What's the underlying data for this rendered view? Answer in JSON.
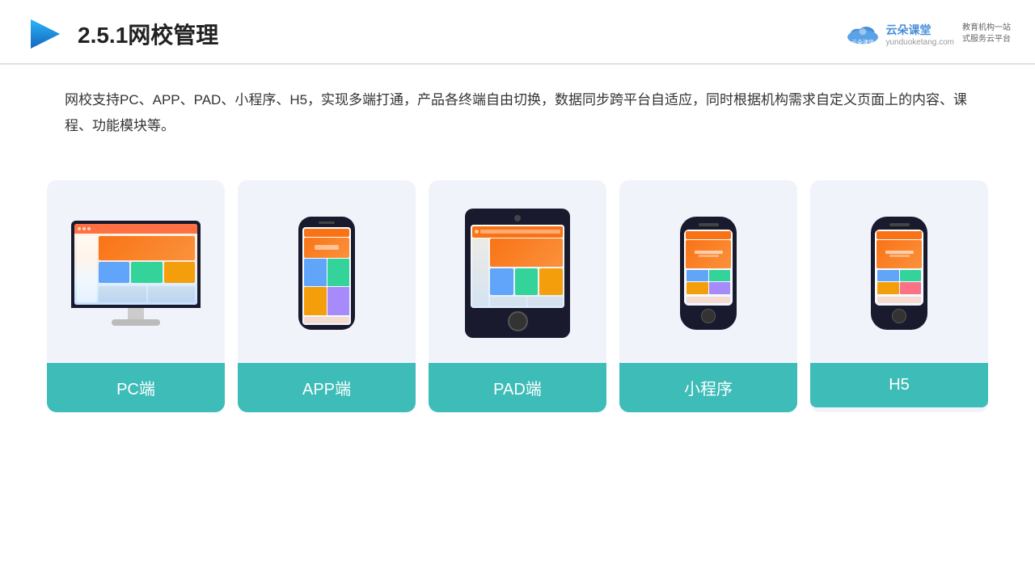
{
  "header": {
    "title": "2.5.1网校管理",
    "brand_name": "云朵课堂",
    "brand_url": "yunduoketang.com",
    "brand_tagline": "教育机构一站\n式服务云平台"
  },
  "description": {
    "text": "网校支持PC、APP、PAD、小程序、H5，实现多端打通，产品各终端自由切换，数据同步跨平台自适应，同时根据机构需求自定义页面上的内容、课程、功能模块等。"
  },
  "cards": [
    {
      "id": "pc",
      "label": "PC端"
    },
    {
      "id": "app",
      "label": "APP端"
    },
    {
      "id": "pad",
      "label": "PAD端"
    },
    {
      "id": "mini",
      "label": "小程序"
    },
    {
      "id": "h5",
      "label": "H5"
    }
  ]
}
